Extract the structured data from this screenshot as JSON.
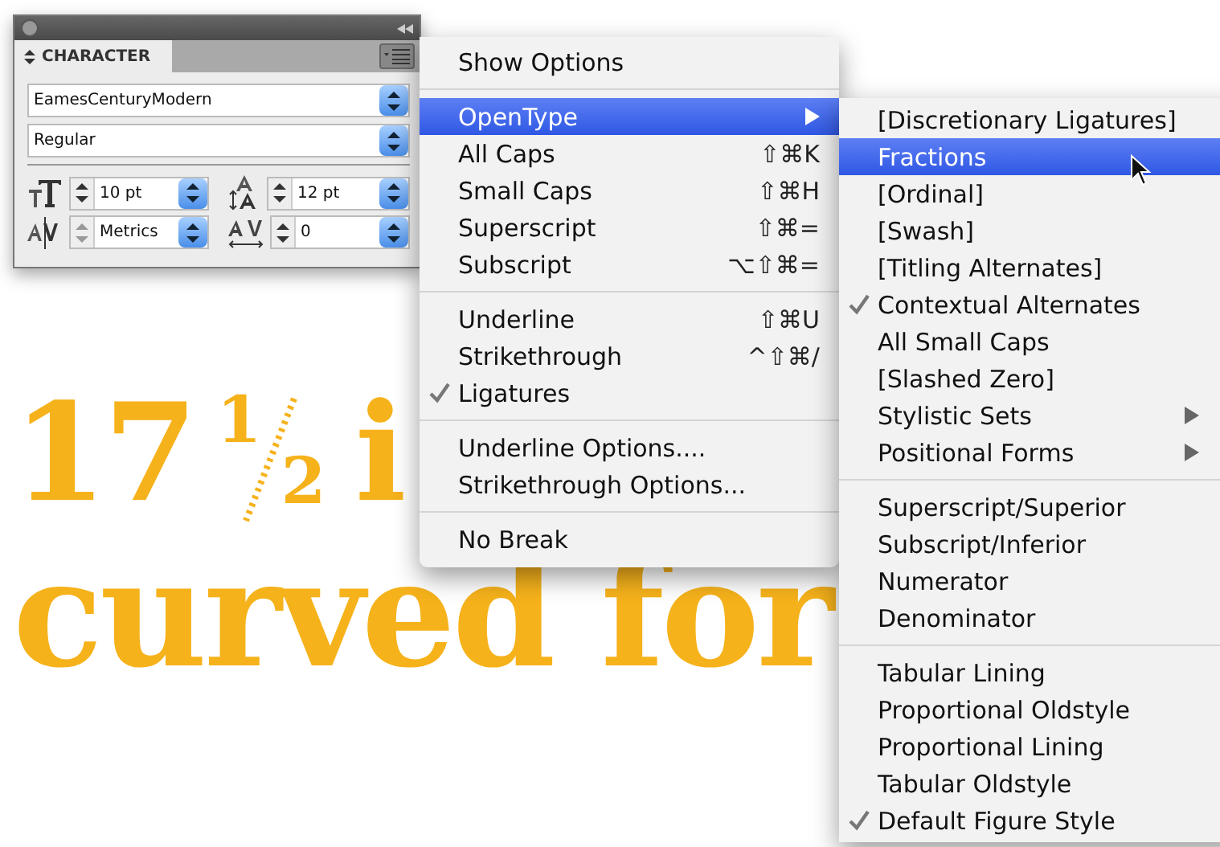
{
  "canvas": {
    "line_1": {
      "number": "17",
      "numerator": "1",
      "denominator": "2",
      "words": "i"
    },
    "line_2": "curved for"
  },
  "panel": {
    "tab": "CHARACTER",
    "font_family": "EamesCenturyModern",
    "font_style": "Regular",
    "size": "10 pt",
    "leading": "12 pt",
    "kerning": "Metrics",
    "tracking": "0"
  },
  "menu": {
    "items": [
      {
        "kind": "item",
        "label": "Show Options",
        "checked": false,
        "selected": false,
        "submenu": false
      },
      {
        "kind": "separator"
      },
      {
        "kind": "item",
        "label": "OpenType",
        "checked": false,
        "selected": true,
        "submenu": true
      },
      {
        "kind": "item",
        "label": "All Caps",
        "shortcut": "⇧⌘K",
        "checked": false,
        "selected": false,
        "submenu": false
      },
      {
        "kind": "item",
        "label": "Small Caps",
        "shortcut": "⇧⌘H",
        "checked": false,
        "selected": false,
        "submenu": false
      },
      {
        "kind": "item",
        "label": "Superscript",
        "shortcut": "⇧⌘=",
        "checked": false,
        "selected": false,
        "submenu": false
      },
      {
        "kind": "item",
        "label": "Subscript",
        "shortcut": "⌥⇧⌘=",
        "checked": false,
        "selected": false,
        "submenu": false
      },
      {
        "kind": "separator"
      },
      {
        "kind": "item",
        "label": "Underline",
        "shortcut": "⇧⌘U",
        "checked": false,
        "selected": false,
        "submenu": false
      },
      {
        "kind": "item",
        "label": "Strikethrough",
        "shortcut": "^⇧⌘/",
        "checked": false,
        "selected": false,
        "submenu": false
      },
      {
        "kind": "item",
        "label": "Ligatures",
        "checked": true,
        "selected": false,
        "submenu": false
      },
      {
        "kind": "separator"
      },
      {
        "kind": "item",
        "label": "Underline Options....",
        "checked": false,
        "selected": false,
        "submenu": false
      },
      {
        "kind": "item",
        "label": "Strikethrough Options...",
        "checked": false,
        "selected": false,
        "submenu": false
      },
      {
        "kind": "separator"
      },
      {
        "kind": "item",
        "label": "No Break",
        "checked": false,
        "selected": false,
        "submenu": false
      }
    ]
  },
  "submenu": {
    "items": [
      {
        "kind": "item",
        "label": "[Discretionary Ligatures]",
        "checked": false,
        "selected": false,
        "submenu": false
      },
      {
        "kind": "item",
        "label": "Fractions",
        "checked": false,
        "selected": true,
        "submenu": false
      },
      {
        "kind": "item",
        "label": "[Ordinal]",
        "checked": false,
        "selected": false,
        "submenu": false
      },
      {
        "kind": "item",
        "label": "[Swash]",
        "checked": false,
        "selected": false,
        "submenu": false
      },
      {
        "kind": "item",
        "label": "[Titling Alternates]",
        "checked": false,
        "selected": false,
        "submenu": false
      },
      {
        "kind": "item",
        "label": "Contextual Alternates",
        "checked": true,
        "selected": false,
        "submenu": false
      },
      {
        "kind": "item",
        "label": "All Small Caps",
        "checked": false,
        "selected": false,
        "submenu": false
      },
      {
        "kind": "item",
        "label": "[Slashed Zero]",
        "checked": false,
        "selected": false,
        "submenu": false
      },
      {
        "kind": "item",
        "label": "Stylistic Sets",
        "checked": false,
        "selected": false,
        "submenu": true
      },
      {
        "kind": "item",
        "label": "Positional Forms",
        "checked": false,
        "selected": false,
        "submenu": true
      },
      {
        "kind": "separator"
      },
      {
        "kind": "item",
        "label": "Superscript/Superior",
        "checked": false,
        "selected": false,
        "submenu": false
      },
      {
        "kind": "item",
        "label": "Subscript/Inferior",
        "checked": false,
        "selected": false,
        "submenu": false
      },
      {
        "kind": "item",
        "label": "Numerator",
        "checked": false,
        "selected": false,
        "submenu": false
      },
      {
        "kind": "item",
        "label": "Denominator",
        "checked": false,
        "selected": false,
        "submenu": false
      },
      {
        "kind": "separator"
      },
      {
        "kind": "item",
        "label": "Tabular Lining",
        "checked": false,
        "selected": false,
        "submenu": false
      },
      {
        "kind": "item",
        "label": "Proportional Oldstyle",
        "checked": false,
        "selected": false,
        "submenu": false
      },
      {
        "kind": "item",
        "label": "Proportional Lining",
        "checked": false,
        "selected": false,
        "submenu": false
      },
      {
        "kind": "item",
        "label": "Tabular Oldstyle",
        "checked": false,
        "selected": false,
        "submenu": false
      },
      {
        "kind": "item",
        "label": "Default Figure Style",
        "checked": true,
        "selected": false,
        "submenu": false
      }
    ]
  }
}
